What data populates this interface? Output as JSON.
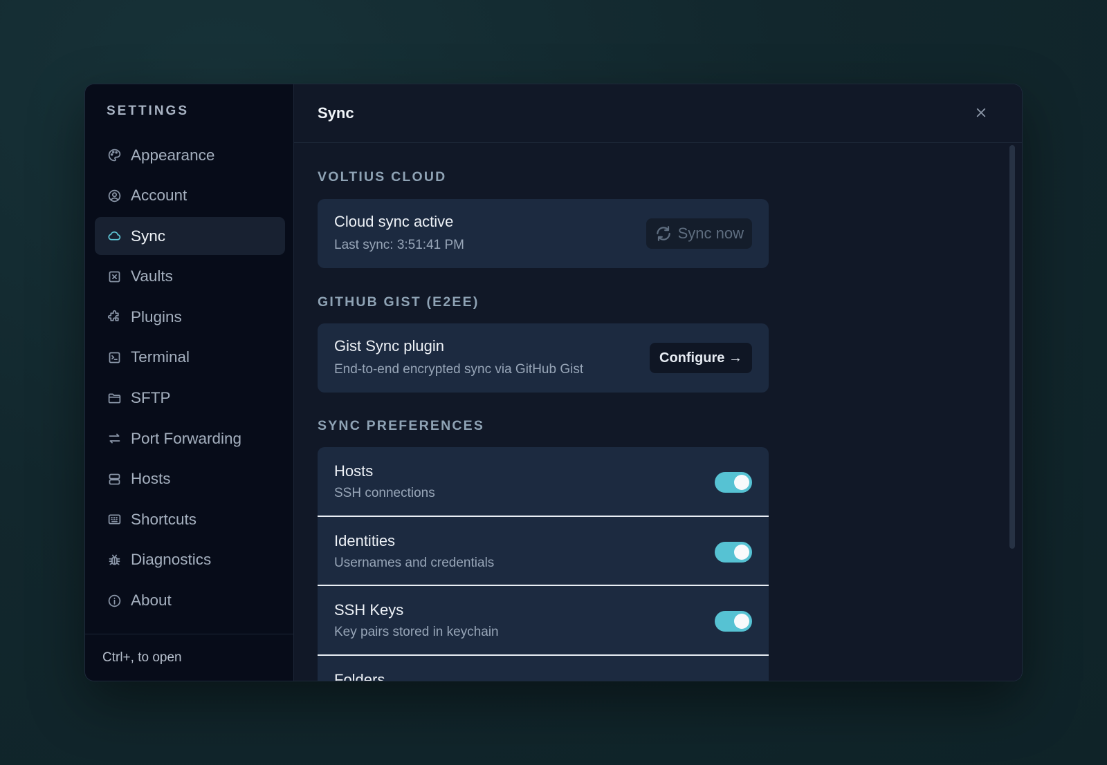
{
  "sidebar": {
    "title": "SETTINGS",
    "items": [
      {
        "label": "Appearance",
        "icon": "palette-icon"
      },
      {
        "label": "Account",
        "icon": "user-circle-icon"
      },
      {
        "label": "Sync",
        "icon": "cloud-icon",
        "active": true
      },
      {
        "label": "Vaults",
        "icon": "vault-icon"
      },
      {
        "label": "Plugins",
        "icon": "puzzle-icon"
      },
      {
        "label": "Terminal",
        "icon": "terminal-icon"
      },
      {
        "label": "SFTP",
        "icon": "folder-icon"
      },
      {
        "label": "Port Forwarding",
        "icon": "arrows-swap-icon"
      },
      {
        "label": "Hosts",
        "icon": "server-icon"
      },
      {
        "label": "Shortcuts",
        "icon": "keyboard-icon"
      },
      {
        "label": "Diagnostics",
        "icon": "bug-icon"
      },
      {
        "label": "About",
        "icon": "info-icon"
      }
    ],
    "footer": "Ctrl+, to open"
  },
  "header": {
    "title": "Sync",
    "close_icon": "close-icon"
  },
  "sections": {
    "cloud": {
      "label": "VOLTIUS CLOUD",
      "title": "Cloud sync active",
      "subtitle": "Last sync: 3:51:41 PM",
      "button": "Sync now",
      "button_icon": "refresh-icon"
    },
    "gist": {
      "label": "GITHUB GIST (E2EE)",
      "title": "Gist Sync plugin",
      "subtitle": "End-to-end encrypted sync via GitHub Gist",
      "button": "Configure →"
    },
    "prefs": {
      "label": "SYNC PREFERENCES",
      "items": [
        {
          "title": "Hosts",
          "subtitle": "SSH connections",
          "enabled": true
        },
        {
          "title": "Identities",
          "subtitle": "Usernames and credentials",
          "enabled": true
        },
        {
          "title": "SSH Keys",
          "subtitle": "Key pairs stored in keychain",
          "enabled": true
        },
        {
          "title": "Folders",
          "subtitle": "",
          "enabled": true
        }
      ]
    }
  },
  "colors": {
    "accent": "#56c2d3",
    "card": "#1c2a40",
    "sidebar": "#070c19"
  }
}
